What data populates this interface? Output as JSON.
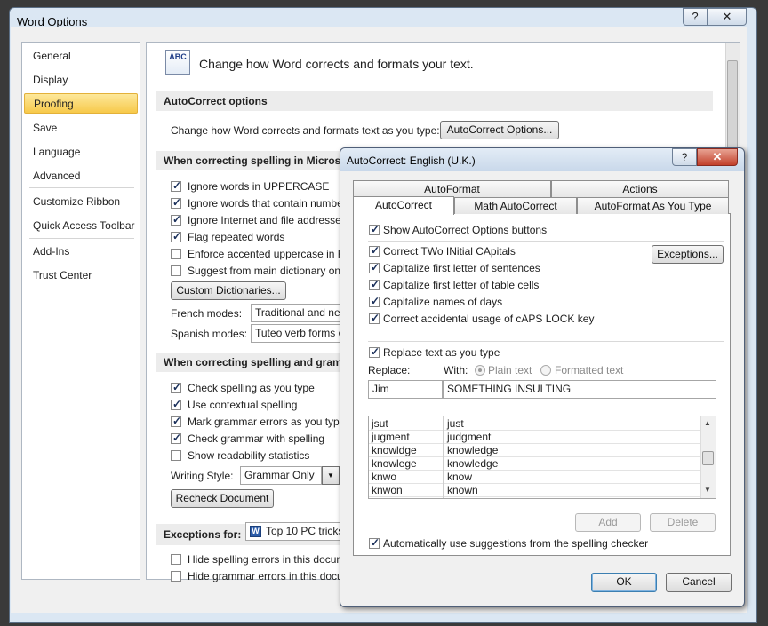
{
  "word_options": {
    "title": "Word Options",
    "help_glyph": "?",
    "close_glyph": "✕",
    "nav": [
      "General",
      "Display",
      "Proofing",
      "Save",
      "Language",
      "Advanced",
      "Customize Ribbon",
      "Quick Access Toolbar",
      "Add-Ins",
      "Trust Center"
    ],
    "nav_selected": "Proofing",
    "header_icon_text": "ABC",
    "header_text": "Change how Word corrects and formats your text.",
    "autocorrect_section": "AutoCorrect options",
    "autocorrect_desc": "Change how Word corrects and formats text as you type:",
    "autocorrect_button": "AutoCorrect Options...",
    "spelling_section": "When correcting spelling in Microsoft",
    "spelling_options": [
      {
        "label": "Ignore words in UPPERCASE",
        "checked": true
      },
      {
        "label": "Ignore words that contain numbe",
        "checked": true
      },
      {
        "label": "Ignore Internet and file addresses",
        "checked": true
      },
      {
        "label": "Flag repeated words",
        "checked": true
      },
      {
        "label": "Enforce accented uppercase in Fr",
        "checked": false
      },
      {
        "label": "Suggest from main dictionary onl",
        "checked": false
      }
    ],
    "custom_dictionaries_button": "Custom Dictionaries...",
    "french_modes_label": "French modes:",
    "french_modes_value": "Traditional and ne",
    "spanish_modes_label": "Spanish modes:",
    "spanish_modes_value": "Tuteo verb forms o",
    "grammar_section": "When correcting spelling and gramma",
    "grammar_options": [
      {
        "label": "Check spelling as you type",
        "checked": true
      },
      {
        "label": "Use contextual spelling",
        "checked": true
      },
      {
        "label": "Mark grammar errors as you type",
        "checked": true
      },
      {
        "label": "Check grammar with spelling",
        "checked": true
      },
      {
        "label": "Show readability statistics",
        "checked": false
      }
    ],
    "writing_style_label": "Writing Style:",
    "writing_style_value": "Grammar Only",
    "dropdown_glyph": "▼",
    "recheck_button": "Recheck Document",
    "exceptions_label": "Exceptions for:",
    "exceptions_value": "Top 10 PC tricks",
    "exceptions_options": [
      {
        "label": "Hide spelling errors in this docum",
        "checked": false
      },
      {
        "label": "Hide grammar errors in this docum",
        "checked": false
      }
    ]
  },
  "autocorrect": {
    "title": "AutoCorrect: English (U.K.)",
    "help_glyph": "?",
    "close_glyph": "✕",
    "tabs_top": [
      "AutoFormat",
      "Actions"
    ],
    "tabs_bottom": [
      "AutoCorrect",
      "Math AutoCorrect",
      "AutoFormat As You Type"
    ],
    "selected_tab": "AutoCorrect",
    "show_buttons": {
      "label": "Show AutoCorrect Options buttons",
      "checked": true
    },
    "options": [
      {
        "label": "Correct TWo INitial CApitals",
        "checked": true
      },
      {
        "label": "Capitalize first letter of sentences",
        "checked": true
      },
      {
        "label": "Capitalize first letter of table cells",
        "checked": true
      },
      {
        "label": "Capitalize names of days",
        "checked": true
      },
      {
        "label": "Correct accidental usage of cAPS LOCK key",
        "checked": true
      }
    ],
    "exceptions_button": "Exceptions...",
    "replace_as_you_type": {
      "label": "Replace text as you type",
      "checked": true
    },
    "replace_label": "Replace:",
    "with_label": "With:",
    "plain_text_label": "Plain text",
    "formatted_text_label": "Formatted text",
    "replace_value": "Jim",
    "with_value": "SOMETHING INSULTING",
    "entries": [
      [
        "jsut",
        "just"
      ],
      [
        "jugment",
        "judgment"
      ],
      [
        "knowldge",
        "knowledge"
      ],
      [
        "knowlege",
        "knowledge"
      ],
      [
        "knwo",
        "know"
      ],
      [
        "knwon",
        "known"
      ]
    ],
    "scroll_up_glyph": "▲",
    "scroll_down_glyph": "▼",
    "add_button": "Add",
    "delete_button": "Delete",
    "auto_suggest": {
      "label": "Automatically use suggestions from the spelling checker",
      "checked": true
    },
    "ok_button": "OK",
    "cancel_button": "Cancel"
  }
}
